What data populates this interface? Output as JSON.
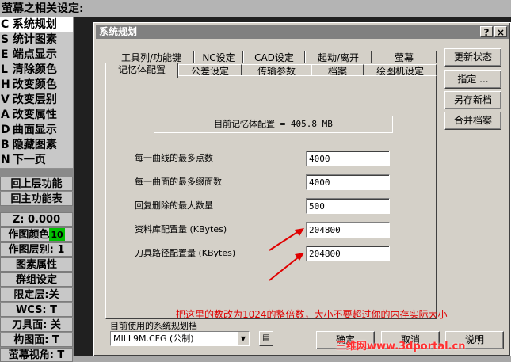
{
  "header": {
    "title": "萤幕之相关设定:"
  },
  "left_menu": {
    "items": [
      {
        "key": "C",
        "label": "系统规划",
        "highlight": true
      },
      {
        "key": "S",
        "label": "统计图素",
        "highlight": false
      },
      {
        "key": "E",
        "label": "端点显示",
        "highlight": false
      },
      {
        "key": "L",
        "label": "清除颜色",
        "highlight": false
      },
      {
        "key": "H",
        "label": "改变颜色",
        "highlight": false
      },
      {
        "key": "V",
        "label": "改变层别",
        "highlight": false
      },
      {
        "key": "A",
        "label": "改变属性",
        "highlight": false
      },
      {
        "key": "D",
        "label": "曲面显示",
        "highlight": false
      },
      {
        "key": "B",
        "label": "隐藏图素",
        "highlight": false
      },
      {
        "key": "N",
        "label": "下一页",
        "highlight": false
      }
    ],
    "nav": [
      "回上层功能",
      "回主功能表"
    ],
    "status": [
      {
        "label": "Z:  0.000"
      },
      {
        "label": "作图颜色",
        "badge": "10"
      },
      {
        "label": "作图层别: 1"
      },
      {
        "label": "图素属性"
      },
      {
        "label": "群组设定"
      },
      {
        "label": "限定层:关"
      },
      {
        "label": "WCS:  T"
      },
      {
        "label": "刀具面: 关"
      },
      {
        "label": "构图面: T"
      },
      {
        "label": "萤幕视角: T"
      }
    ]
  },
  "dialog": {
    "title": "系统规划",
    "help": "?",
    "close": "×",
    "tabs_back": [
      "工具列/功能键",
      "NC设定",
      "CAD设定",
      "起动/离开",
      "萤幕"
    ],
    "tabs_front": [
      "记忆体配置",
      "公差设定",
      "传输参数",
      "档案",
      "绘图机设定"
    ],
    "memory_info": "目前记忆体配置 = 405.8 MB",
    "fields": [
      {
        "label": "每一曲线的最多点数",
        "value": "4000"
      },
      {
        "label": "每一曲面的最多缀面数",
        "value": "4000"
      },
      {
        "label": "回复删除的最大数量",
        "value": "500"
      },
      {
        "label": "资料库配置量 (KBytes)",
        "value": "204800"
      },
      {
        "label": "刀具路径配置量 (KBytes)",
        "value": "204800"
      }
    ],
    "note": "把这里的数改为1024的整倍数，大小不要超过你的内存实际大小",
    "side_buttons": [
      "更新状态",
      "指定 ...",
      "另存新档",
      "合并档案"
    ],
    "current_label": "目前使用的系统规划档",
    "current_value": "MILL9M.CFG (公制)",
    "bottom_buttons": [
      "确定",
      "取消",
      "说明"
    ],
    "watermark": "三维网www.3dportal.cn",
    "accent_color": "#e00000"
  }
}
